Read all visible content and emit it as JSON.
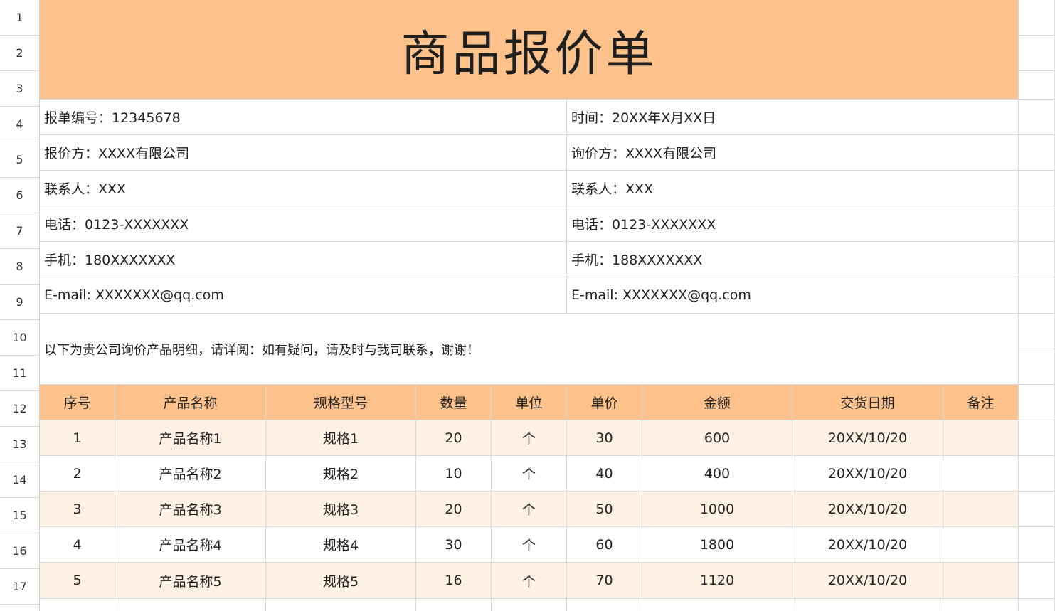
{
  "title": "商品报价单",
  "row_numbers": [
    "1",
    "2",
    "3",
    "4",
    "5",
    "6",
    "7",
    "8",
    "9",
    "10",
    "11",
    "12",
    "13",
    "14",
    "15",
    "16",
    "17",
    ""
  ],
  "info": {
    "left": [
      "报单编号：12345678",
      "报价方：XXXX有限公司",
      "联系人：XXX",
      "电话：0123-XXXXXXX",
      "手机：180XXXXXXX",
      "E-mail: XXXXXXX@qq.com"
    ],
    "right": [
      "时间：20XX年X月XX日",
      "询价方：XXXX有限公司",
      "联系人：XXX",
      "电话：0123-XXXXXXX",
      "手机：188XXXXXXX",
      "E-mail: XXXXXXX@qq.com"
    ]
  },
  "note": "以下为贵公司询价产品明细，请详阅：如有疑问，请及时与我司联系，谢谢！",
  "table": {
    "headers": [
      "序号",
      "产品名称",
      "规格型号",
      "数量",
      "单位",
      "单价",
      "金额",
      "交货日期",
      "备注"
    ],
    "rows": [
      [
        "1",
        "产品名称1",
        "规格1",
        "20",
        "个",
        "30",
        "600",
        "20XX/10/20",
        ""
      ],
      [
        "2",
        "产品名称2",
        "规格2",
        "10",
        "个",
        "40",
        "400",
        "20XX/10/20",
        ""
      ],
      [
        "3",
        "产品名称3",
        "规格3",
        "20",
        "个",
        "50",
        "1000",
        "20XX/10/20",
        ""
      ],
      [
        "4",
        "产品名称4",
        "规格4",
        "30",
        "个",
        "60",
        "1800",
        "20XX/10/20",
        ""
      ],
      [
        "5",
        "产品名称5",
        "规格5",
        "16",
        "个",
        "70",
        "1120",
        "20XX/10/20",
        ""
      ]
    ]
  },
  "colors": {
    "header_fill": "#fdc28c",
    "stripe_fill": "#fff1e4",
    "grid": "#d9d9d9"
  }
}
